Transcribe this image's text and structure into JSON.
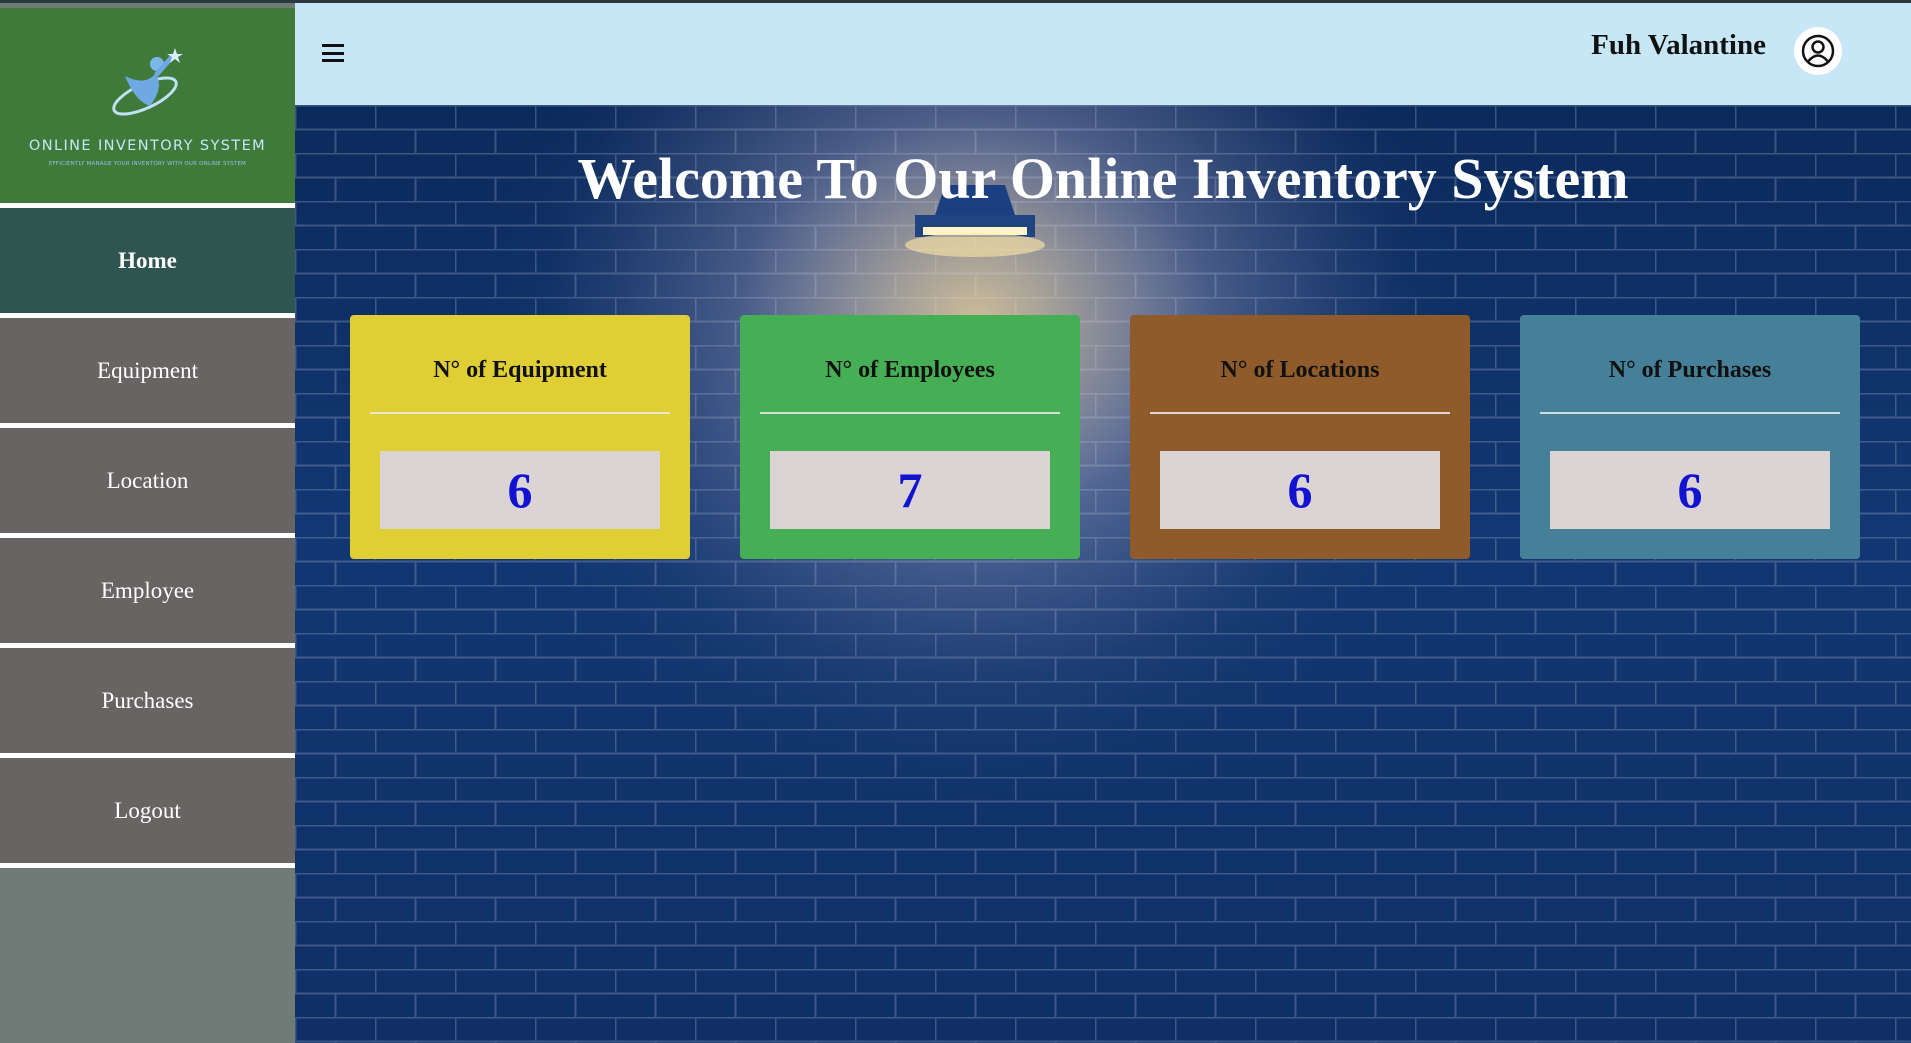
{
  "sidebar": {
    "logo_title": "ONLINE INVENTORY SYSTEM",
    "logo_subtitle": "EFFICIENTLY MANAGE YOUR INVENTORY WITH OUR ONLINE SYSTEM",
    "items": [
      {
        "label": "Home",
        "active": true
      },
      {
        "label": "Equipment"
      },
      {
        "label": "Location"
      },
      {
        "label": "Employee"
      },
      {
        "label": "Purchases"
      },
      {
        "label": "Logout"
      }
    ]
  },
  "header": {
    "menu_icon": "hamburger-icon",
    "username": "Fuh Valantine",
    "avatar_icon": "user-circle-icon"
  },
  "main": {
    "welcome": "Welcome To Our Online Inventory System",
    "cards": [
      {
        "title": "N° of Equipment",
        "value": "6",
        "color": "#e0cf34"
      },
      {
        "title": "N° of Employees",
        "value": "7",
        "color": "#46ae55"
      },
      {
        "title": "N° of Locations",
        "value": "6",
        "color": "#8f5b2b"
      },
      {
        "title": "N° of Purchases",
        "value": "6",
        "color": "#467f98"
      }
    ]
  },
  "colors": {
    "sidebar_active": "#2f5551",
    "sidebar_item": "#686463",
    "logo_bg": "#3f7a3b",
    "header_bg": "#c7e7f6",
    "value_text": "#1212d1"
  }
}
